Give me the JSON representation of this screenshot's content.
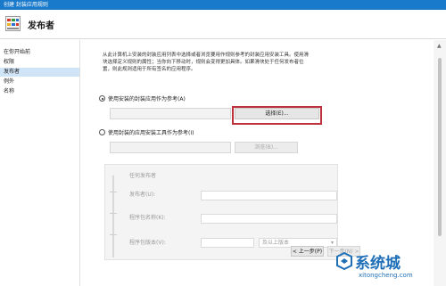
{
  "window": {
    "title": "创建 封装应用规则"
  },
  "header": {
    "title": "发布者"
  },
  "sidebar": {
    "items": [
      {
        "label": "在你开始前",
        "active": false
      },
      {
        "label": "权限",
        "active": false
      },
      {
        "label": "发布者",
        "active": true
      },
      {
        "label": "例外",
        "active": false
      },
      {
        "label": "名称",
        "active": false
      }
    ]
  },
  "main": {
    "description_lines": [
      "从此计算机上安装的封装应用列表中选择或者浏览要用作规则参考的封装应用安装工具。使用滑",
      "块选择定义规则的属性；当你向下移动时，规则会变得更加具体。如果滑块处于任何发布者位",
      "置，则此规则适用于所有签名的应用程序。"
    ],
    "option_installed": {
      "label": "使用安装的封装应用作为参考(A)",
      "checked": true
    },
    "select_button_label": "选择(E)...",
    "option_installer": {
      "label": "使用封装的应用安装工具作为参考(I)",
      "checked": false
    },
    "browse_button_label": "浏览(B)...",
    "publisher_panel": {
      "any_publisher_label": "任何发布者",
      "publisher_label": "发布者(U):",
      "package_name_label": "程序包名称(K):",
      "package_version_label": "程序包版本(V):",
      "version_option": "及以上版本"
    }
  },
  "footer": {
    "back_label": "< 上一步(P)",
    "next_label": "下一步(N) >"
  },
  "watermark": {
    "text": "系统城",
    "url": "xitongcheng.com"
  },
  "colors": {
    "titlebar": "#1979ca",
    "sidebar_active": "#cfe4f7",
    "highlight_border": "#c0303a",
    "watermark": "#1e6fb8"
  }
}
